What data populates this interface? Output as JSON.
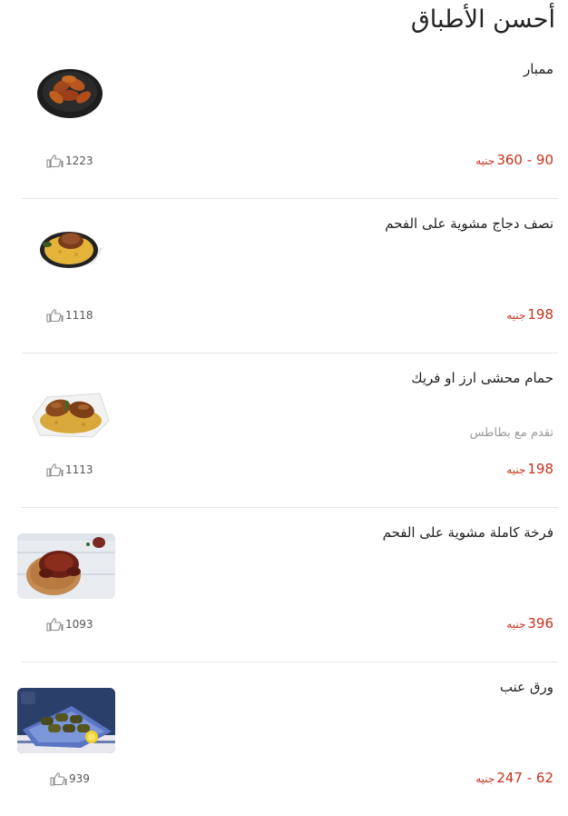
{
  "section": {
    "title": "أحسن الأطباق"
  },
  "dishes": [
    {
      "name": "ممبار",
      "description": "",
      "price": "90 - 360",
      "currency": "جنيه",
      "likes": "1223",
      "image": "mombar-plate"
    },
    {
      "name": "نصف دجاج مشوية على الفحم",
      "description": "",
      "price": "198",
      "currency": "جنيه",
      "likes": "1118",
      "image": "grilled-half-chicken"
    },
    {
      "name": "حمام محشى ارز او فريك",
      "description": "تقدم مع بطاطس",
      "price": "198",
      "currency": "جنيه",
      "likes": "1113",
      "image": "stuffed-pigeon"
    },
    {
      "name": "فرخة كاملة مشوية على الفحم",
      "description": "",
      "price": "396",
      "currency": "جنيه",
      "likes": "1093",
      "image": "whole-grilled-chicken"
    },
    {
      "name": "ورق عنب",
      "description": "",
      "price": "62 - 247",
      "currency": "جنيه",
      "likes": "939",
      "image": "grape-leaves"
    }
  ],
  "icons": {
    "like": "thumbs-up-icon"
  },
  "colors": {
    "price": "#c8321e",
    "divider": "#e6e6e6",
    "description": "#9a9a9a"
  }
}
